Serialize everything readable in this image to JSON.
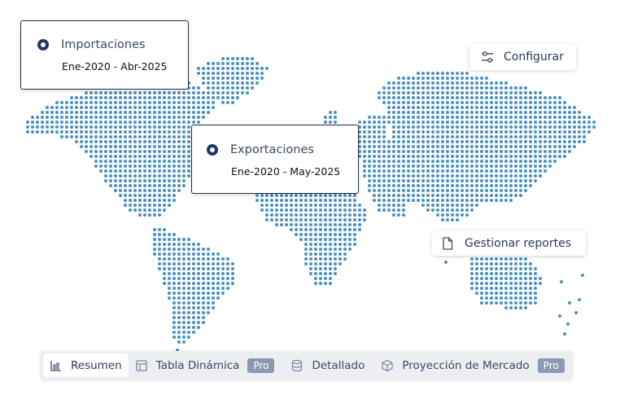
{
  "cards": {
    "import": {
      "title": "Importaciones",
      "range": "Ene-2020 - Abr-2025"
    },
    "export": {
      "title": "Exportaciones",
      "range": "Ene-2020 - May-2025"
    }
  },
  "actions": {
    "configure": {
      "label": "Configurar",
      "icon": "sliders-icon"
    },
    "reports": {
      "label": "Gestionar reportes",
      "icon": "document-icon"
    }
  },
  "tabs": [
    {
      "label": "Resumen",
      "icon": "bar-chart-icon",
      "active": true,
      "badge": ""
    },
    {
      "label": "Tabla Dinámica",
      "icon": "table-icon",
      "active": false,
      "badge": "Pro"
    },
    {
      "label": "Detallado",
      "icon": "database-icon",
      "active": false,
      "badge": ""
    },
    {
      "label": "Proyección de Mercado",
      "icon": "cube-icon",
      "active": false,
      "badge": "Pro"
    }
  ],
  "colors": {
    "dot": "#4a90c2",
    "accent": "#1f3a64",
    "badge": "#8a9ab3"
  }
}
